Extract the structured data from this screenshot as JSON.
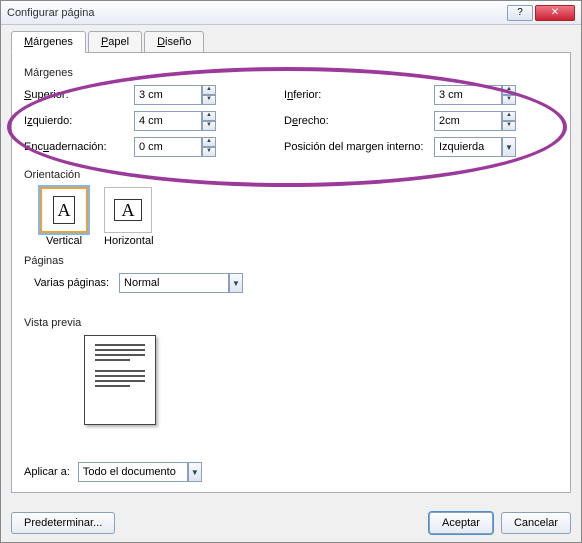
{
  "window": {
    "title": "Configurar página"
  },
  "tabs": [
    {
      "label": "Márgenes",
      "accel": "M",
      "active": true
    },
    {
      "label": "Papel",
      "accel": "P"
    },
    {
      "label": "Diseño",
      "accel": "D"
    }
  ],
  "margins_section": {
    "header": "Márgenes",
    "fields": {
      "superior_label": "Superior:",
      "superior_value": "3 cm",
      "inferior_label": "Inferior:",
      "inferior_value": "3 cm",
      "izquierdo_label": "Izquierdo:",
      "izquierdo_value": "4 cm",
      "derecho_label": "Derecho:",
      "derecho_value": "2cm",
      "encuad_label": "Encuadernación:",
      "encuad_value": "0 cm",
      "pos_label": "Posición del margen interno:",
      "pos_value": "Izquierda"
    }
  },
  "orientation_section": {
    "header": "Orientación",
    "vertical_label": "Vertical",
    "horizontal_label": "Horizontal"
  },
  "pages_section": {
    "header": "Páginas",
    "varias_label": "Varias páginas:",
    "varias_value": "Normal"
  },
  "preview_section": {
    "header": "Vista previa"
  },
  "apply_section": {
    "label": "Aplicar a:",
    "value": "Todo el documento"
  },
  "buttons": {
    "predeterminar": "Predeterminar...",
    "aceptar": "Aceptar",
    "cancelar": "Cancelar"
  }
}
